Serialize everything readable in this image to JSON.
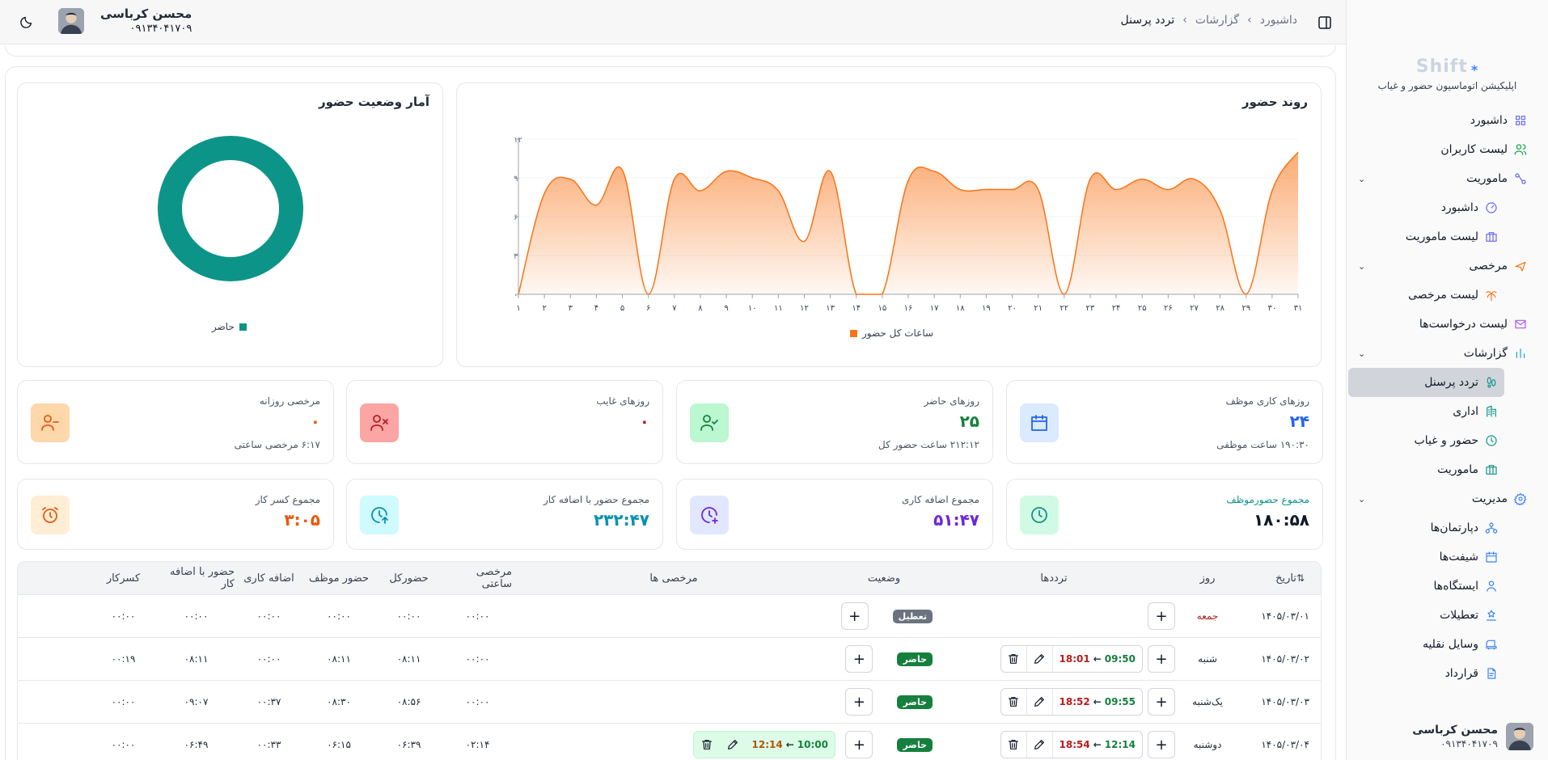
{
  "breadcrumb": {
    "items": [
      "داشبورد",
      "گزارشات",
      "تردد پرسنل"
    ]
  },
  "user": {
    "name": "محسن کرباسی",
    "phone": "۰۹۱۳۴۰۴۱۷۰۹"
  },
  "app": {
    "brand": "Shift",
    "subtitle": "اپلیکیشن اتوماسیون حضور و غیاب"
  },
  "sidebar": {
    "items": [
      {
        "label": "داشبورد",
        "icon": "dashboard-icon",
        "color": "#6366f1"
      },
      {
        "label": "لیست کاربران",
        "icon": "users-icon",
        "color": "#16a34a"
      },
      {
        "label": "ماموریت",
        "icon": "mission-icon",
        "color": "#6366f1",
        "expanded": true,
        "children": [
          {
            "label": "داشبورد",
            "icon": "gauge-icon",
            "color": "#6366f1"
          },
          {
            "label": "لیست ماموریت",
            "icon": "briefcase-icon",
            "color": "#6366f1"
          }
        ]
      },
      {
        "label": "مرخصی",
        "icon": "plane-icon",
        "color": "#f97316",
        "expanded": true,
        "children": [
          {
            "label": "لیست مرخصی",
            "icon": "palm-icon",
            "color": "#f97316"
          }
        ]
      },
      {
        "label": "لیست درخواست‌ها",
        "icon": "mail-icon",
        "color": "#a855f7"
      },
      {
        "label": "گزارشات",
        "icon": "bar-chart-icon",
        "color": "#0ea5e9",
        "expanded": true,
        "children": [
          {
            "label": "تردد پرسنل",
            "icon": "footprint-icon",
            "color": "#0d9488",
            "active": true
          },
          {
            "label": "اداری",
            "icon": "building-icon",
            "color": "#0d9488"
          },
          {
            "label": "حضور و غیاب",
            "icon": "clock-icon",
            "color": "#0d9488"
          },
          {
            "label": "ماموریت",
            "icon": "briefcase-icon",
            "color": "#0d9488"
          }
        ]
      },
      {
        "label": "مدیریت",
        "icon": "settings-icon",
        "color": "#3b82f6",
        "expanded": true,
        "children": [
          {
            "label": "دپارتمان‌ها",
            "icon": "org-icon",
            "color": "#3b82f6"
          },
          {
            "label": "شیفت‌ها",
            "icon": "calendar-icon",
            "color": "#3b82f6"
          },
          {
            "label": "ایستگاه‌ها",
            "icon": "station-icon",
            "color": "#3b82f6"
          },
          {
            "label": "تعطیلات",
            "icon": "holiday-icon",
            "color": "#3b82f6"
          },
          {
            "label": "وسایل نقلیه",
            "icon": "car-icon",
            "color": "#3b82f6"
          },
          {
            "label": "قرارداد",
            "icon": "contract-icon",
            "color": "#3b82f6"
          }
        ]
      }
    ]
  },
  "attendance_chart": {
    "title": "روند حضور",
    "legend": "ساعات کل حضور",
    "color": "#f97316",
    "chart_data": {
      "type": "area",
      "title": "روند حضور",
      "x": [
        "۱",
        "۲",
        "۳",
        "۴",
        "۵",
        "۶",
        "۷",
        "۸",
        "۹",
        "۱۰",
        "۱۱",
        "۱۲",
        "۱۳",
        "۱۴",
        "۱۵",
        "۱۶",
        "۱۷",
        "۱۸",
        "۱۹",
        "۲۰",
        "۲۱",
        "۲۲",
        "۲۳",
        "۲۴",
        "۲۵",
        "۲۶",
        "۲۷",
        "۲۸",
        "۲۹",
        "۳۰",
        "۳۱"
      ],
      "y_ticks": [
        "۰",
        "۳",
        "۶",
        "۹",
        "۱۲"
      ],
      "ylim": [
        0,
        12
      ],
      "series": [
        {
          "name": "ساعات کل حضور",
          "values": [
            0,
            7.8,
            8.9,
            6.9,
            9.6,
            0,
            8.9,
            8.0,
            9.5,
            9.0,
            8.0,
            4.1,
            9.5,
            0,
            0,
            8.8,
            9.5,
            8.1,
            8.1,
            8.1,
            8.1,
            0,
            8.9,
            8.1,
            8.9,
            8.1,
            8.9,
            6.5,
            0,
            8.0,
            11.0
          ]
        }
      ]
    }
  },
  "donut": {
    "title": "آمار وضعیت حضور",
    "legend": "حاضر",
    "color": "#0d9488",
    "chart_data": {
      "type": "pie",
      "categories": [
        "حاضر"
      ],
      "values": [
        100
      ]
    }
  },
  "stats_row1": [
    {
      "label": "روزهای کاری موظف",
      "value": "۲۴",
      "sub": "۱۹۰:۳۰ ساعت موظفی",
      "value_color": "#2563eb",
      "icon": "calendar-icon",
      "icon_bg": "#dbeafe",
      "icon_color": "#2563eb"
    },
    {
      "label": "روزهای حاضر",
      "value": "۲۵",
      "sub": "۲۱۲:۱۲ ساعت حضور کل",
      "value_color": "#15803d",
      "icon": "user-check-icon",
      "icon_bg": "#bbf7d0",
      "icon_color": "#15803d"
    },
    {
      "label": "روزهای غایب",
      "value": "۰",
      "sub": "",
      "value_color": "#b91c1c",
      "icon": "user-x-icon",
      "icon_bg": "#fca5a5",
      "icon_color": "#b91c1c"
    },
    {
      "label": "مرخصی روزانه",
      "value": "۰",
      "sub": "۶:۱۷ مرخصی ساعتی",
      "value_color": "#ea580c",
      "icon": "user-minus-icon",
      "icon_bg": "#fed7aa",
      "icon_color": "#ea580c"
    }
  ],
  "stats_row2": [
    {
      "label": "مجموع حضورموظف",
      "value": "۱۸۰:۵۸",
      "label_color": "#0d9488",
      "value_color": "#111827",
      "icon": "clock-icon",
      "icon_bg": "#d1fae5",
      "icon_color": "#0d9488"
    },
    {
      "label": "مجموع اضافه کاری",
      "value": "۵۱:۴۷",
      "value_color": "#6d28d9",
      "icon": "clock-plus-icon",
      "icon_bg": "#e0e7ff",
      "icon_color": "#6d28d9"
    },
    {
      "label": "مجموع حضور با اضافه کار",
      "value": "۲۳۲:۴۷",
      "value_color": "#0891b2",
      "icon": "clock-up-icon",
      "icon_bg": "#cffafe",
      "icon_color": "#0891b2"
    },
    {
      "label": "مجموع کسر کار",
      "value": "۳:۰۵",
      "value_color": "#ea580c",
      "icon": "alarm-icon",
      "icon_bg": "#ffedd5",
      "icon_color": "#ea580c"
    }
  ],
  "table": {
    "headers": [
      "تاریخ",
      "روز",
      "ترددها",
      "وضعیت",
      "مرخصی ها",
      "مرخصی ساعتی",
      "حضورکل",
      "حضور موظف",
      "اضافه کاری",
      "حضور با اضافه کار",
      "کسرکار"
    ],
    "rows": [
      {
        "date": "۱۴۰۵/۰۳/۰۱",
        "day": "جمعه",
        "day_red": true,
        "entries": [],
        "status": "تعطیل",
        "status_kind": "gray",
        "leaves": [],
        "hourly_leave": "۰۰:۰۰",
        "total": "۰۰:۰۰",
        "required": "۰۰:۰۰",
        "overtime": "۰۰:۰۰",
        "with_overtime": "۰۰:۰۰",
        "deficit": "۰۰:۰۰"
      },
      {
        "date": "۱۴۰۵/۰۳/۰۲",
        "day": "شنبه",
        "entries": [
          {
            "in": "09:50",
            "out": "18:01"
          }
        ],
        "status": "حاضر",
        "status_kind": "green",
        "leaves": [],
        "hourly_leave": "۰۰:۰۰",
        "total": "۰۸:۱۱",
        "required": "۰۸:۱۱",
        "overtime": "۰۰:۰۰",
        "with_overtime": "۰۸:۱۱",
        "deficit": "۰۰:۱۹"
      },
      {
        "date": "۱۴۰۵/۰۳/۰۳",
        "day": "یک‌شنبه",
        "entries": [
          {
            "in": "09:55",
            "out": "18:52"
          }
        ],
        "status": "حاضر",
        "status_kind": "green",
        "leaves": [],
        "hourly_leave": "۰۰:۰۰",
        "total": "۰۸:۵۶",
        "required": "۰۸:۳۰",
        "overtime": "۰۰:۳۷",
        "with_overtime": "۰۹:۰۷",
        "deficit": "۰۰:۰۰"
      },
      {
        "date": "۱۴۰۵/۰۳/۰۴",
        "day": "دوشنبه",
        "entries": [
          {
            "in": "12:14",
            "out": "18:54"
          }
        ],
        "status": "حاضر",
        "status_kind": "green",
        "leaves": [
          {
            "from": "10:00",
            "to": "12:14"
          }
        ],
        "hourly_leave": "۰۲:۱۴",
        "total": "۰۶:۳۹",
        "required": "۰۶:۱۵",
        "overtime": "۰۰:۳۳",
        "with_overtime": "۰۶:۴۹",
        "deficit": "۰۰:۰۰"
      }
    ]
  }
}
